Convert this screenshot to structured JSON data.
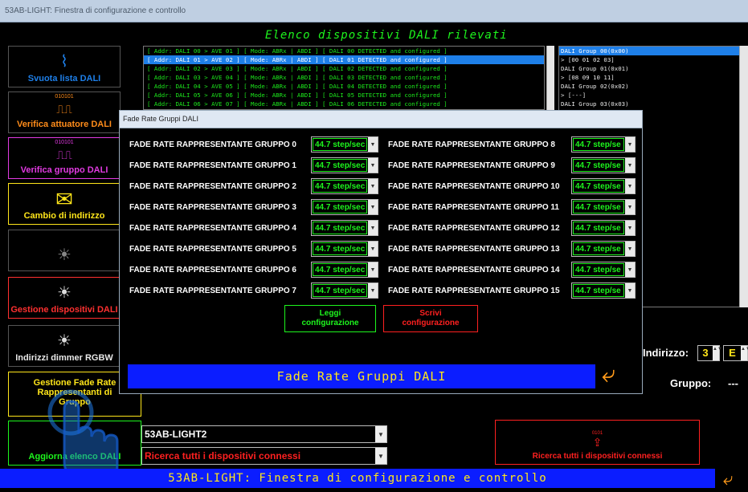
{
  "window": {
    "title": "53AB-LIGHT: Finestra di configurazione e controllo"
  },
  "header": {
    "title": "Elenco dispositivi DALI rilevati"
  },
  "sidebar": {
    "items": [
      {
        "label": "Svuota lista DALI",
        "icon": "broom-icon",
        "icon_glyph": "🧹",
        "color": "#1e7fe8"
      },
      {
        "label": "Verifica attuatore DALI",
        "icon": "signal-wave-icon",
        "icon_glyph": "010101",
        "color": "#ff8c1a"
      },
      {
        "label": "Verifica gruppo DALI",
        "icon": "signal-wave-icon",
        "icon_glyph": "010101",
        "color": "#e23ae2"
      },
      {
        "label": "Cambio di indirizzo",
        "icon": "envelope-icon",
        "icon_glyph": "✉",
        "color": "#ffe61a"
      },
      {
        "label": "",
        "icon": "bulb-icon",
        "icon_glyph": "💡",
        "color": "#aaa"
      },
      {
        "label": "Gestione dispositivi DALI",
        "icon": "bulb-icon",
        "icon_glyph": "💡",
        "color": "#ff3030"
      },
      {
        "label": "Indirizzi dimmer RGBW",
        "icon": "bulb-icon",
        "icon_glyph": "💡",
        "color": "#e8e8e8"
      },
      {
        "label": "Gestione Fade Rate Rappresentanti di Gruppo",
        "icon": "",
        "icon_glyph": "",
        "color": "#ffe61a"
      },
      {
        "label": "Aggiorna elenco DALI",
        "icon": "update-icon",
        "icon_glyph": "",
        "color": "#1df51d"
      }
    ]
  },
  "log": {
    "lines": [
      "[ Addr: DALI 00 > AVE 01 ] [ Mode: ABRx | ABDI ] [ DALI 00 DETECTED and configured ]",
      "[ Addr: DALI 01 > AVE 02 ] [ Mode: ABRx | ABDI ] [ DALI 01 DETECTED and configured ]",
      "[ Addr: DALI 02 > AVE 03 ] [ Mode: ABRx | ABDI ] [ DALI 02 DETECTED and configured ]",
      "[ Addr: DALI 03 > AVE 04 ] [ Mode: ABRx | ABDI ] [ DALI 03 DETECTED and configured ]",
      "[ Addr: DALI 04 > AVE 05 ] [ Mode: ABRx | ABDI ] [ DALI 04 DETECTED and configured ]",
      "[ Addr: DALI 05 > AVE 06 ] [ Mode: ABRx | ABDI ] [ DALI 05 DETECTED and configured ]",
      "[ Addr: DALI 06 > AVE 07 ] [ Mode: ABRx | ABDI ] [ DALI 06 DETECTED and configured ]"
    ]
  },
  "groups": {
    "lines": [
      "DALI Group 00(0x00)",
      "  > [00 01 02 03]",
      "DALI Group 01(0x01)",
      "  > [08 09 10 11]",
      "DALI Group 02(0x02)",
      "  > [---]",
      "DALI Group 03(0x03)"
    ]
  },
  "dialog": {
    "title": "Fade Rate Gruppi DALI",
    "rows_left": [
      {
        "label": "FADE RATE RAPPRESENTANTE GRUPPO 0",
        "value": "44.7 step/sec"
      },
      {
        "label": "FADE RATE RAPPRESENTANTE GRUPPO 1",
        "value": "44.7 step/sec"
      },
      {
        "label": "FADE RATE RAPPRESENTANTE GRUPPO 2",
        "value": "44.7 step/sec"
      },
      {
        "label": "FADE RATE RAPPRESENTANTE GRUPPO 3",
        "value": "44.7 step/sec"
      },
      {
        "label": "FADE RATE RAPPRESENTANTE GRUPPO 4",
        "value": "44.7 step/sec"
      },
      {
        "label": "FADE RATE RAPPRESENTANTE GRUPPO 5",
        "value": "44.7 step/sec"
      },
      {
        "label": "FADE RATE RAPPRESENTANTE GRUPPO 6",
        "value": "44.7 step/sec"
      },
      {
        "label": "FADE RATE RAPPRESENTANTE GRUPPO 7",
        "value": "44.7 step/sec"
      }
    ],
    "rows_right": [
      {
        "label": "FADE RATE RAPPRESENTANTE GRUPPO 8",
        "value": "44.7 step/se"
      },
      {
        "label": "FADE RATE RAPPRESENTANTE GRUPPO 9",
        "value": "44.7 step/se"
      },
      {
        "label": "FADE RATE RAPPRESENTANTE GRUPPO 10",
        "value": "44.7 step/se"
      },
      {
        "label": "FADE RATE RAPPRESENTANTE GRUPPO 11",
        "value": "44.7 step/se"
      },
      {
        "label": "FADE RATE RAPPRESENTANTE GRUPPO 12",
        "value": "44.7 step/se"
      },
      {
        "label": "FADE RATE RAPPRESENTANTE GRUPPO 13",
        "value": "44.7 step/se"
      },
      {
        "label": "FADE RATE RAPPRESENTANTE GRUPPO 14",
        "value": "44.7 step/se"
      },
      {
        "label": "FADE RATE RAPPRESENTANTE GRUPPO 15",
        "value": "44.7 step/se"
      }
    ],
    "read_button": "Leggi configurazione",
    "write_button": "Scrivi configurazione",
    "footer": "Fade Rate Gruppi DALI"
  },
  "right_panel": {
    "address_label": "Indirizzo:",
    "address_value": "3",
    "address_letter": "E",
    "group_label": "Gruppo:",
    "group_value": "---"
  },
  "bottom": {
    "device_combo": "53AB-LIGHT2",
    "search_combo": "Ricerca tutti i dispositivi connessi",
    "search_button": "Ricerca tutti i dispositivi connessi",
    "search_icon_text": "0101",
    "footer": "53AB-LIGHT: Finestra di configurazione e controllo"
  },
  "colors": {
    "accent_green": "#1df51d",
    "accent_blue": "#0b1dff",
    "title_yellow": "#ffe61a",
    "warning_red": "#ff2020"
  }
}
